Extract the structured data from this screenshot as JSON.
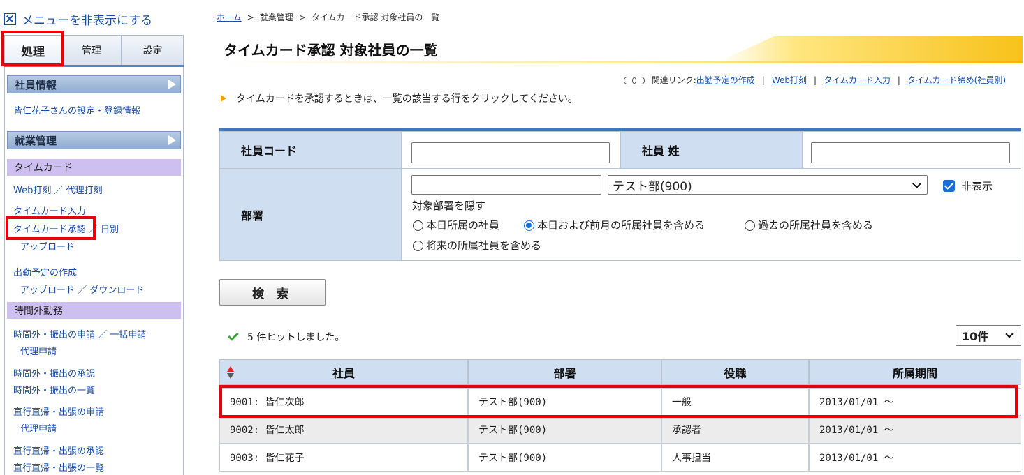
{
  "sidebar": {
    "toggle_label": "メニューを非表示にする",
    "tabs": [
      {
        "label": "処理"
      },
      {
        "label": "管理"
      },
      {
        "label": "設定"
      }
    ],
    "employee_info": {
      "header": "社員情報",
      "link": "皆仁花子さんの設定・登録情報"
    },
    "work_mgmt": {
      "header": "就業管理",
      "timecard_header": "タイムカード",
      "web_punch": "Web打刻",
      "proxy_punch": "代理打刻",
      "timecard_input": "タイムカード入力",
      "timecard_approval": "タイムカード承認",
      "daily": "日別",
      "upload": "アップロード",
      "schedule_create": "出勤予定の作成",
      "schedule_upload": "アップロード",
      "schedule_download": "ダウンロード",
      "sep": "／"
    },
    "overtime": {
      "header": "時間外勤務",
      "request": "時間外・振出の申請",
      "bulk_request": "一括申請",
      "proxy_request": "代理申請",
      "approval": "時間外・振出の承認",
      "list": "時間外・振出の一覧",
      "trip_request": "直行直帰・出張の申請",
      "trip_proxy": "代理申請",
      "trip_approval": "直行直帰・出張の承認",
      "trip_list": "直行直帰・出張の一覧"
    }
  },
  "breadcrumb": {
    "home": "ホーム",
    "sep": ">",
    "level2": "就業管理",
    "current": "タイムカード承認 対象社員の一覧"
  },
  "page_title": "タイムカード承認 対象社員の一覧",
  "related": {
    "label": "関連リンク:",
    "links": [
      "出勤予定の作成",
      "Web打刻",
      "タイムカード入力",
      "タイムカード締め(社員別)"
    ],
    "sep": "|"
  },
  "instruction": "タイムカードを承認するときは、一覧の該当する行をクリックしてください。",
  "form": {
    "emp_code_label": "社員コード",
    "emp_code_value": "",
    "last_name_label": "社員 姓",
    "last_name_value": "",
    "dept_label": "部署",
    "dept_input_value": "",
    "dept_select": "テスト部(900)",
    "hide_label": "非表示",
    "hide_checked": true,
    "hide_dept_text": "対象部署を隠す",
    "radio_options": [
      "本日所属の社員",
      "本日および前月の所属社員を含める",
      "過去の所属社員を含める",
      "将来の所属社員を含める"
    ],
    "radio_selected": "本日および前月の所属社員を含める"
  },
  "search_button": "検 索",
  "hit_text": "5 件ヒットしました。",
  "per_page": "10件",
  "table": {
    "headers": [
      "社員",
      "部署",
      "役職",
      "所属期間"
    ],
    "rows": [
      [
        "9001: 皆仁次郎",
        "テスト部(900)",
        "一般",
        "2013/01/01 ～"
      ],
      [
        "9002: 皆仁太郎",
        "テスト部(900)",
        "承認者",
        "2013/01/01 ～"
      ],
      [
        "9003: 皆仁花子",
        "テスト部(900)",
        "人事担当",
        "2013/01/01 ～"
      ]
    ]
  },
  "colors": {
    "link": "#1a4ea8",
    "highlight": "#e8000b",
    "header_bg": "#cfdff1",
    "accent_blue": "#3c78c6",
    "title_gold": "#f7c21a"
  }
}
